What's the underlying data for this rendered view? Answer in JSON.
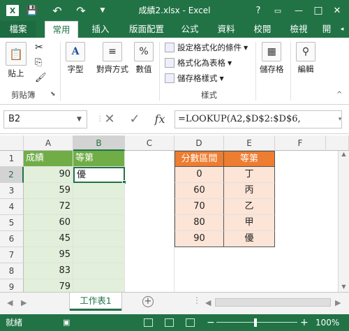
{
  "window": {
    "title": "成績2.xlsx - Excel",
    "controls": {
      "help": "?",
      "minimize": "—",
      "restore": "□",
      "close": "✕"
    },
    "quick_access": {
      "app_icon": "X",
      "save": "💾",
      "undo": "↶",
      "redo": "↷"
    }
  },
  "ribbon_tabs": [
    "檔案",
    "常用",
    "插入",
    "版面配置",
    "公式",
    "資料",
    "校閱",
    "檢視",
    "開"
  ],
  "active_tab": "常用",
  "ribbon": {
    "clipboard": {
      "paste": "貼上",
      "group": "剪貼簿"
    },
    "font": {
      "label": "字型"
    },
    "alignment": {
      "label": "對齊方式"
    },
    "number": {
      "label": "數值"
    },
    "styles": {
      "conditional": "設定格式化的條件",
      "format_table": "格式化為表格",
      "cell_styles": "儲存格樣式",
      "group": "樣式"
    },
    "cells": {
      "label": "儲存格"
    },
    "editing": {
      "label": "編輯"
    }
  },
  "formula_bar": {
    "name_box": "B2",
    "cancel": "✕",
    "confirm": "✓",
    "fx": "fx",
    "formula": "=LOOKUP(A2,$D$2:$D$6,"
  },
  "grid": {
    "columns": [
      "A",
      "B",
      "C",
      "D",
      "E",
      "F"
    ],
    "rows": [
      "1",
      "2",
      "3",
      "4",
      "5",
      "6",
      "7",
      "8",
      "9"
    ],
    "A1": "成績",
    "B1": "等第",
    "B2": "優",
    "scores": [
      "90",
      "59",
      "72",
      "60",
      "45",
      "95",
      "83",
      "79"
    ],
    "D1": "分數區間",
    "E1": "等第",
    "lookup_ranges": [
      "0",
      "60",
      "70",
      "80",
      "90"
    ],
    "lookup_grades": [
      "丁",
      "丙",
      "乙",
      "甲",
      "優"
    ]
  },
  "sheets": {
    "active": "工作表1",
    "add": "+"
  },
  "status": {
    "ready": "就緒",
    "zoom": "100%",
    "zoom_minus": "−",
    "zoom_plus": "+"
  },
  "colors": {
    "excel_green": "#217346",
    "header_green": "#70ad47",
    "column_fill": "#e2efda",
    "orange_header": "#ed7d31",
    "peach_fill": "#fce4d6"
  }
}
